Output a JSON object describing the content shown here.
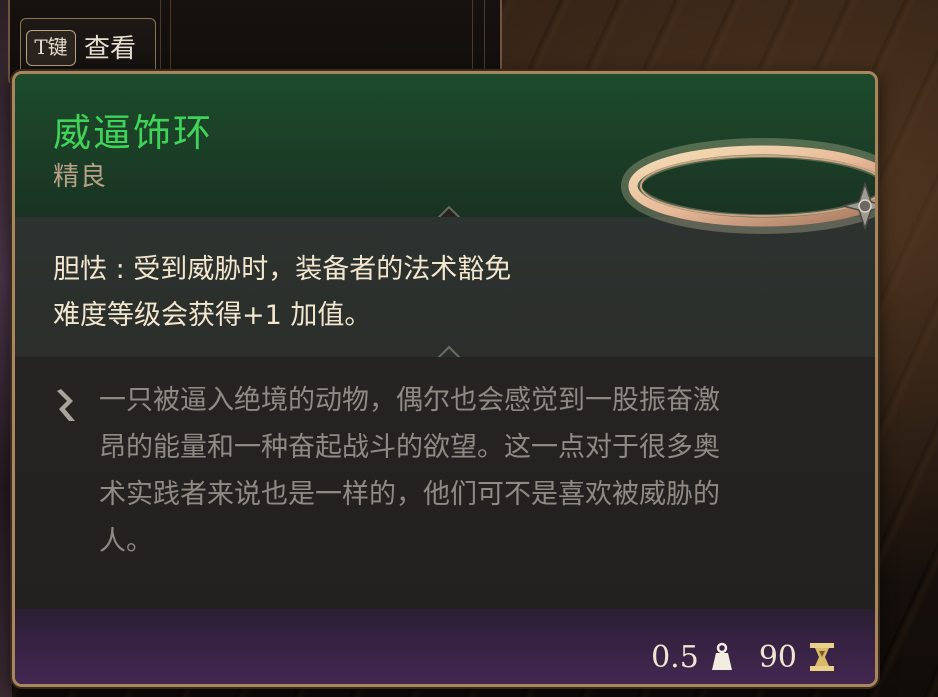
{
  "hotkey": {
    "key": "T键",
    "label": "查看"
  },
  "item": {
    "name": "威逼饰环",
    "rarity": "精良",
    "rarity_color": "#3fd35a",
    "effect": {
      "line1": "胆怯 : 受到威胁时，装备者的法术豁免",
      "line2": "难度等级会获得+1 加值。"
    },
    "flavor": [
      "一只被逼入绝境的动物，偶尔也会感觉到一股振奋激",
      "昂的能量和一种奋起战斗的欲望。这一点对于很多奥",
      "术实践者来说也是一样的，他们可不是喜欢被威胁的",
      "人。"
    ],
    "weight": "0.5",
    "weight_icon": "weight-icon",
    "price": "90",
    "price_icon": "gold-icon"
  }
}
